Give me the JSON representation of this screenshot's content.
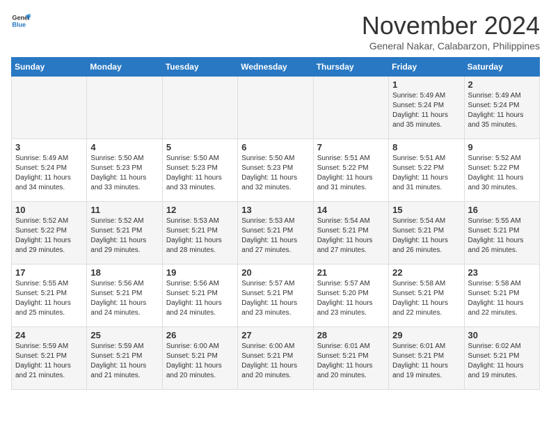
{
  "logo": {
    "line1": "General",
    "line2": "Blue"
  },
  "title": "November 2024",
  "location": "General Nakar, Calabarzon, Philippines",
  "days_of_week": [
    "Sunday",
    "Monday",
    "Tuesday",
    "Wednesday",
    "Thursday",
    "Friday",
    "Saturday"
  ],
  "weeks": [
    [
      {
        "day": "",
        "info": ""
      },
      {
        "day": "",
        "info": ""
      },
      {
        "day": "",
        "info": ""
      },
      {
        "day": "",
        "info": ""
      },
      {
        "day": "",
        "info": ""
      },
      {
        "day": "1",
        "info": "Sunrise: 5:49 AM\nSunset: 5:24 PM\nDaylight: 11 hours\nand 35 minutes."
      },
      {
        "day": "2",
        "info": "Sunrise: 5:49 AM\nSunset: 5:24 PM\nDaylight: 11 hours\nand 35 minutes."
      }
    ],
    [
      {
        "day": "3",
        "info": "Sunrise: 5:49 AM\nSunset: 5:24 PM\nDaylight: 11 hours\nand 34 minutes."
      },
      {
        "day": "4",
        "info": "Sunrise: 5:50 AM\nSunset: 5:23 PM\nDaylight: 11 hours\nand 33 minutes."
      },
      {
        "day": "5",
        "info": "Sunrise: 5:50 AM\nSunset: 5:23 PM\nDaylight: 11 hours\nand 33 minutes."
      },
      {
        "day": "6",
        "info": "Sunrise: 5:50 AM\nSunset: 5:23 PM\nDaylight: 11 hours\nand 32 minutes."
      },
      {
        "day": "7",
        "info": "Sunrise: 5:51 AM\nSunset: 5:22 PM\nDaylight: 11 hours\nand 31 minutes."
      },
      {
        "day": "8",
        "info": "Sunrise: 5:51 AM\nSunset: 5:22 PM\nDaylight: 11 hours\nand 31 minutes."
      },
      {
        "day": "9",
        "info": "Sunrise: 5:52 AM\nSunset: 5:22 PM\nDaylight: 11 hours\nand 30 minutes."
      }
    ],
    [
      {
        "day": "10",
        "info": "Sunrise: 5:52 AM\nSunset: 5:22 PM\nDaylight: 11 hours\nand 29 minutes."
      },
      {
        "day": "11",
        "info": "Sunrise: 5:52 AM\nSunset: 5:21 PM\nDaylight: 11 hours\nand 29 minutes."
      },
      {
        "day": "12",
        "info": "Sunrise: 5:53 AM\nSunset: 5:21 PM\nDaylight: 11 hours\nand 28 minutes."
      },
      {
        "day": "13",
        "info": "Sunrise: 5:53 AM\nSunset: 5:21 PM\nDaylight: 11 hours\nand 27 minutes."
      },
      {
        "day": "14",
        "info": "Sunrise: 5:54 AM\nSunset: 5:21 PM\nDaylight: 11 hours\nand 27 minutes."
      },
      {
        "day": "15",
        "info": "Sunrise: 5:54 AM\nSunset: 5:21 PM\nDaylight: 11 hours\nand 26 minutes."
      },
      {
        "day": "16",
        "info": "Sunrise: 5:55 AM\nSunset: 5:21 PM\nDaylight: 11 hours\nand 26 minutes."
      }
    ],
    [
      {
        "day": "17",
        "info": "Sunrise: 5:55 AM\nSunset: 5:21 PM\nDaylight: 11 hours\nand 25 minutes."
      },
      {
        "day": "18",
        "info": "Sunrise: 5:56 AM\nSunset: 5:21 PM\nDaylight: 11 hours\nand 24 minutes."
      },
      {
        "day": "19",
        "info": "Sunrise: 5:56 AM\nSunset: 5:21 PM\nDaylight: 11 hours\nand 24 minutes."
      },
      {
        "day": "20",
        "info": "Sunrise: 5:57 AM\nSunset: 5:21 PM\nDaylight: 11 hours\nand 23 minutes."
      },
      {
        "day": "21",
        "info": "Sunrise: 5:57 AM\nSunset: 5:20 PM\nDaylight: 11 hours\nand 23 minutes."
      },
      {
        "day": "22",
        "info": "Sunrise: 5:58 AM\nSunset: 5:21 PM\nDaylight: 11 hours\nand 22 minutes."
      },
      {
        "day": "23",
        "info": "Sunrise: 5:58 AM\nSunset: 5:21 PM\nDaylight: 11 hours\nand 22 minutes."
      }
    ],
    [
      {
        "day": "24",
        "info": "Sunrise: 5:59 AM\nSunset: 5:21 PM\nDaylight: 11 hours\nand 21 minutes."
      },
      {
        "day": "25",
        "info": "Sunrise: 5:59 AM\nSunset: 5:21 PM\nDaylight: 11 hours\nand 21 minutes."
      },
      {
        "day": "26",
        "info": "Sunrise: 6:00 AM\nSunset: 5:21 PM\nDaylight: 11 hours\nand 20 minutes."
      },
      {
        "day": "27",
        "info": "Sunrise: 6:00 AM\nSunset: 5:21 PM\nDaylight: 11 hours\nand 20 minutes."
      },
      {
        "day": "28",
        "info": "Sunrise: 6:01 AM\nSunset: 5:21 PM\nDaylight: 11 hours\nand 20 minutes."
      },
      {
        "day": "29",
        "info": "Sunrise: 6:01 AM\nSunset: 5:21 PM\nDaylight: 11 hours\nand 19 minutes."
      },
      {
        "day": "30",
        "info": "Sunrise: 6:02 AM\nSunset: 5:21 PM\nDaylight: 11 hours\nand 19 minutes."
      }
    ]
  ]
}
